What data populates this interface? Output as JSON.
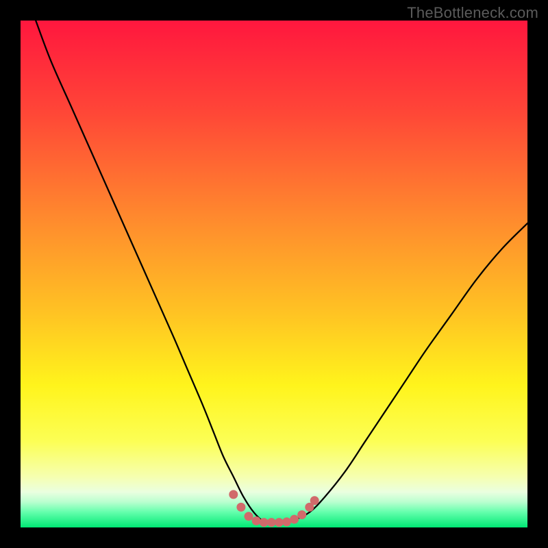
{
  "watermark": "TheBottleneck.com",
  "chart_data": {
    "type": "line",
    "title": "",
    "xlabel": "",
    "ylabel": "",
    "xlim": [
      0,
      100
    ],
    "ylim": [
      0,
      100
    ],
    "gradient": {
      "stops": [
        {
          "pct": 0,
          "color": "#ff173e"
        },
        {
          "pct": 18,
          "color": "#ff4637"
        },
        {
          "pct": 40,
          "color": "#ff8d2d"
        },
        {
          "pct": 58,
          "color": "#ffc423"
        },
        {
          "pct": 72,
          "color": "#fff41c"
        },
        {
          "pct": 83,
          "color": "#fcff55"
        },
        {
          "pct": 90,
          "color": "#f6ffb0"
        },
        {
          "pct": 93,
          "color": "#eaffe0"
        },
        {
          "pct": 95,
          "color": "#b9ffcf"
        },
        {
          "pct": 97,
          "color": "#63ffac"
        },
        {
          "pct": 100,
          "color": "#00e874"
        }
      ]
    },
    "series": [
      {
        "name": "bottleneck-curve",
        "color": "#000000",
        "width": 2.3,
        "type": "line",
        "x": [
          3,
          6,
          10,
          14,
          18,
          22,
          26,
          30,
          33,
          36,
          38,
          40,
          42,
          44,
          46,
          48,
          50,
          52,
          54,
          57,
          60,
          64,
          68,
          72,
          76,
          80,
          85,
          90,
          95,
          100
        ],
        "y": [
          100,
          92,
          83,
          74,
          65,
          56,
          47,
          38,
          31,
          24,
          19,
          14,
          10,
          6,
          3,
          1.2,
          1,
          1.1,
          1.5,
          3,
          6,
          11,
          17,
          23,
          29,
          35,
          42,
          49,
          55,
          60
        ]
      },
      {
        "name": "sweet-spot-markers",
        "color": "#d16a6b",
        "type": "scatter",
        "marker_radius": 6.5,
        "x": [
          42.0,
          43.5,
          45.0,
          46.5,
          48.0,
          49.5,
          51.0,
          52.5,
          54.0,
          55.5,
          57.0,
          58.0
        ],
        "y": [
          6.5,
          4.0,
          2.2,
          1.3,
          1.0,
          1.0,
          1.0,
          1.1,
          1.6,
          2.5,
          4.0,
          5.3
        ]
      }
    ]
  }
}
